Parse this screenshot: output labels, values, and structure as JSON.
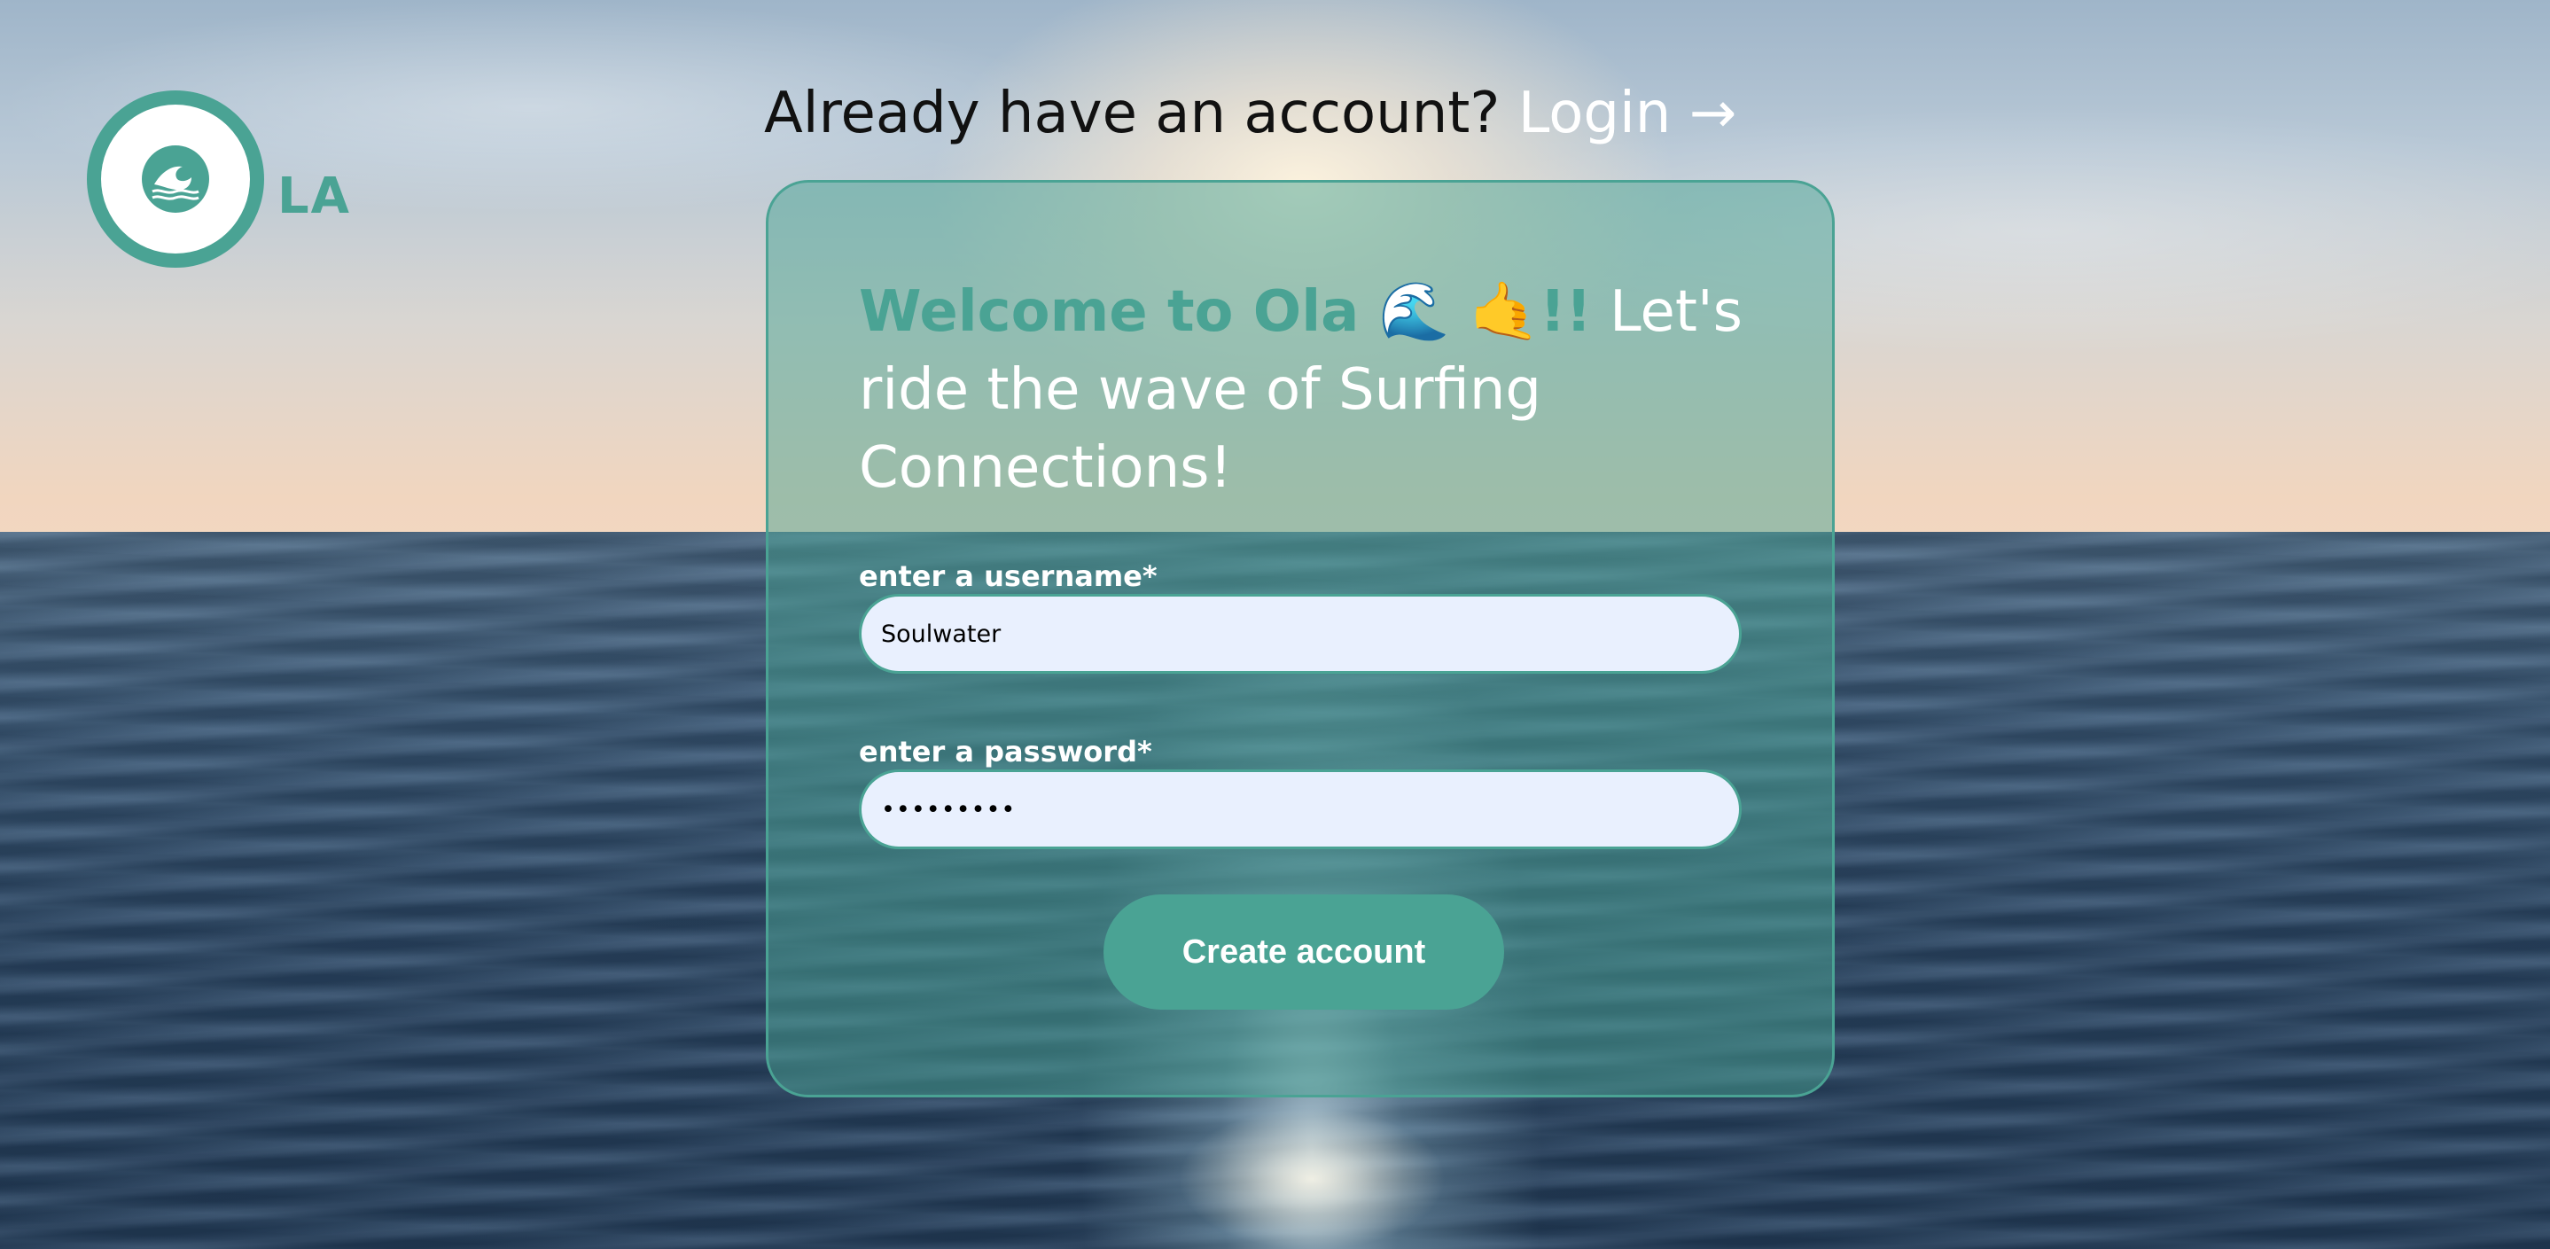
{
  "brand": {
    "logo_text": "LA",
    "accent_color": "#4aa394",
    "logo_icon": "wave-icon"
  },
  "header": {
    "prompt": "Already have an account?",
    "login_label": "Login →"
  },
  "card": {
    "welcome_accent": "Welcome to Ola 🌊 🤙!!",
    "welcome_rest": " Let's ride the wave of Surfing Connections!",
    "username_label": "enter a username*",
    "username_value": "Soulwater",
    "password_label": "enter a password*",
    "password_value": "•••••••••",
    "create_button_label": "Create account"
  }
}
